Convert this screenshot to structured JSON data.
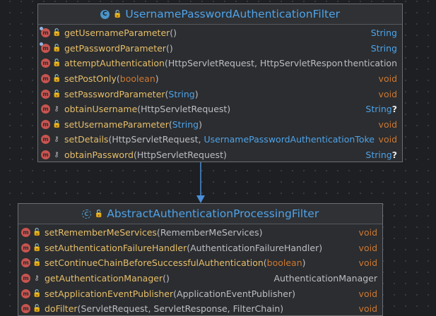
{
  "top_class": {
    "title": "UsernamePasswordAuthenticationFilter",
    "type_icon": "class-icon",
    "methods": [
      {
        "name": "getUsernameParameter",
        "params": [],
        "return": "String",
        "return_style": "type",
        "visibility": "public",
        "overridden": true
      },
      {
        "name": "getPasswordParameter",
        "params": [],
        "return": "String",
        "return_style": "type",
        "visibility": "public",
        "overridden": true
      },
      {
        "name": "attemptAuthentication",
        "params": [
          {
            "text": "HttpServletRequest",
            "style": "plain"
          },
          {
            "text": "HttpServletResponse",
            "style": "plain"
          }
        ],
        "return": "Authentication",
        "return_style": "plain-clipped",
        "visibility": "public",
        "overridden": false
      },
      {
        "name": "setPostOnly",
        "params": [
          {
            "text": "boolean",
            "style": "keyword"
          }
        ],
        "return": "void",
        "return_style": "void",
        "visibility": "public",
        "overridden": false
      },
      {
        "name": "setPasswordParameter",
        "params": [
          {
            "text": "String",
            "style": "highlight"
          }
        ],
        "return": "void",
        "return_style": "void",
        "visibility": "public",
        "overridden": false
      },
      {
        "name": "obtainUsername",
        "params": [
          {
            "text": "HttpServletRequest",
            "style": "plain"
          }
        ],
        "return": "String",
        "return_suffix": "?",
        "return_style": "type",
        "visibility": "protected",
        "overridden": false
      },
      {
        "name": "setUsernameParameter",
        "params": [
          {
            "text": "String",
            "style": "highlight"
          }
        ],
        "return": "void",
        "return_style": "void",
        "visibility": "public",
        "overridden": false
      },
      {
        "name": "setDetails",
        "params": [
          {
            "text": "HttpServletRequest",
            "style": "plain"
          },
          {
            "text": "UsernamePasswordAuthenticationToken",
            "style": "highlight"
          }
        ],
        "return": "void",
        "return_style": "void",
        "visibility": "protected",
        "overridden": false
      },
      {
        "name": "obtainPassword",
        "params": [
          {
            "text": "HttpServletRequest",
            "style": "plain"
          }
        ],
        "return": "String",
        "return_suffix": "?",
        "return_style": "type",
        "visibility": "protected",
        "overridden": false
      }
    ]
  },
  "bottom_class": {
    "title": "AbstractAuthenticationProcessingFilter",
    "type_icon": "abstract-class-icon",
    "methods": [
      {
        "name": "setRememberMeServices",
        "params": [
          {
            "text": "RememberMeServices",
            "style": "plain"
          }
        ],
        "return": "void",
        "return_style": "void",
        "visibility": "public",
        "overridden": false
      },
      {
        "name": "setAuthenticationFailureHandler",
        "params": [
          {
            "text": "AuthenticationFailureHandler",
            "style": "plain"
          }
        ],
        "return": "void",
        "return_style": "void",
        "visibility": "public",
        "overridden": false
      },
      {
        "name": "setContinueChainBeforeSuccessfulAuthentication",
        "params": [
          {
            "text": "boolean",
            "style": "keyword"
          }
        ],
        "return": "void",
        "return_style": "void",
        "visibility": "public",
        "overridden": false
      },
      {
        "name": "getAuthenticationManager",
        "params": [],
        "return": "AuthenticationManager",
        "return_style": "plain",
        "visibility": "protected",
        "overridden": false
      },
      {
        "name": "setApplicationEventPublisher",
        "params": [
          {
            "text": "ApplicationEventPublisher",
            "style": "plain"
          }
        ],
        "return": "void",
        "return_style": "void",
        "visibility": "public",
        "overridden": false
      },
      {
        "name": "doFilter",
        "params": [
          {
            "text": "ServletRequest",
            "style": "plain"
          },
          {
            "text": "ServletResponse",
            "style": "plain"
          },
          {
            "text": "FilterChain",
            "style": "plain"
          }
        ],
        "return": "void",
        "return_style": "void",
        "visibility": "public",
        "overridden": false
      }
    ]
  },
  "colors": {
    "background": "#1e1f22",
    "box_background": "#2b2d30",
    "title": "#4fa3e9",
    "method_name": "#e8bf6a",
    "keyword": "#cc7832",
    "type_highlight": "#4fa3e9",
    "method_badge": "#c75450",
    "public_marker": "#57a64a",
    "arrow": "#4a8fd9"
  }
}
